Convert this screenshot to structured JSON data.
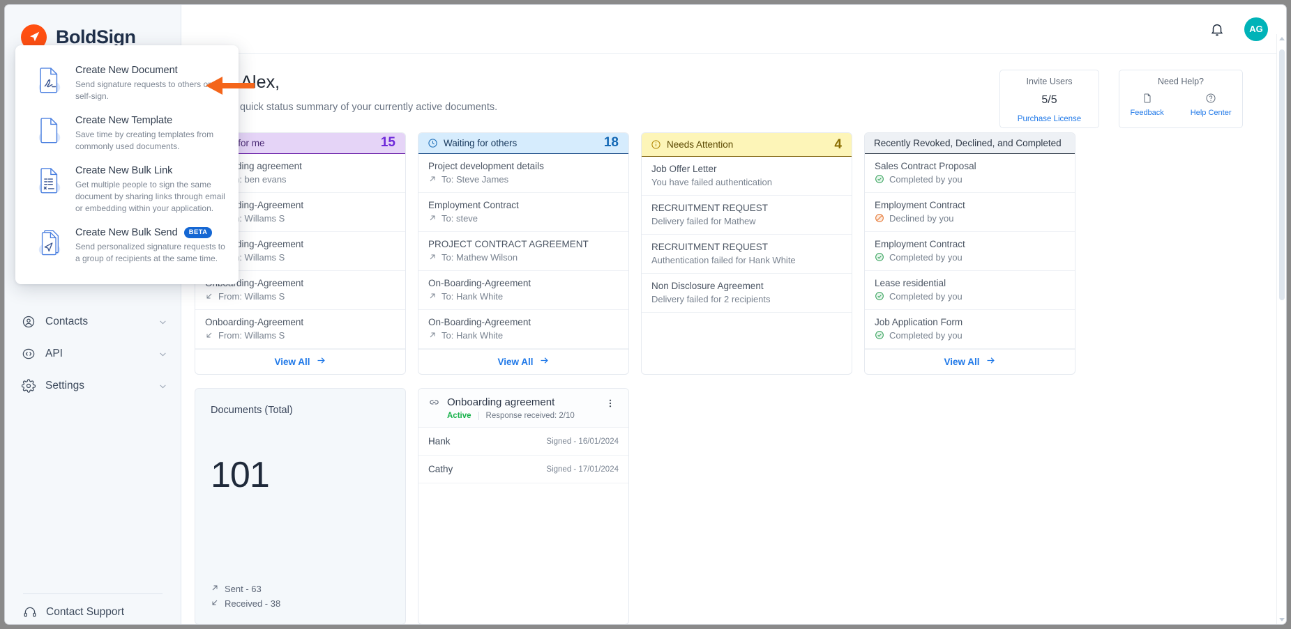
{
  "brand": {
    "name": "BoldSign"
  },
  "topbar": {
    "notification_icon": "bell-icon",
    "avatar_initials": "AG"
  },
  "sidebar": {
    "items": [
      {
        "label": "Contacts",
        "icon": "user-circle-icon"
      },
      {
        "label": "API",
        "icon": "code-circle-icon"
      },
      {
        "label": "Settings",
        "icon": "gear-icon"
      }
    ],
    "support": {
      "label": "Contact Support",
      "icon": "headset-icon"
    }
  },
  "dropdown": {
    "items": [
      {
        "title": "Create New Document",
        "desc": "Send signature requests to others or self-sign.",
        "icon": "document-sign-icon",
        "badge": ""
      },
      {
        "title": "Create New Template",
        "desc": "Save time by creating templates from commonly used documents.",
        "icon": "document-blank-icon",
        "badge": ""
      },
      {
        "title": "Create New Bulk Link",
        "desc": "Get multiple people to sign the same document by sharing links through email or embedding within your application.",
        "icon": "document-list-icon",
        "badge": ""
      },
      {
        "title": "Create New Bulk Send",
        "desc": "Send personalized signature requests to a group of recipients at the same time.",
        "icon": "document-send-icon",
        "badge": "BETA"
      }
    ]
  },
  "greeting": {
    "title": "Hello Alex,",
    "subtitle": "Here is a quick status summary of your currently active documents."
  },
  "header_cards": {
    "invite": {
      "title": "Invite Users",
      "value": "5/5",
      "link": "Purchase License"
    },
    "help": {
      "title": "Need Help?",
      "actions": [
        {
          "label": "Feedback",
          "icon": "document-icon"
        },
        {
          "label": "Help Center",
          "icon": "question-circle-icon"
        }
      ]
    }
  },
  "status_cards": [
    {
      "title": "Waiting for me",
      "count": "15",
      "icon": "",
      "theme": "purple",
      "items": [
        {
          "title": "Onboarding agreement",
          "sub": "From: ben evans",
          "dir": "in"
        },
        {
          "title": "Onboarding-Agreement",
          "sub": "From: Willams S",
          "dir": "in"
        },
        {
          "title": "Onboarding-Agreement",
          "sub": "From: Willams S",
          "dir": "in"
        },
        {
          "title": "Onboarding-Agreement",
          "sub": "From: Willams S",
          "dir": "in"
        },
        {
          "title": "Onboarding-Agreement",
          "sub": "From: Willams S",
          "dir": "in"
        }
      ],
      "footer": "View All"
    },
    {
      "title": "Waiting for others",
      "count": "18",
      "icon": "clock-icon",
      "theme": "blue",
      "items": [
        {
          "title": "Project development details",
          "sub": "To: Steve James",
          "dir": "out"
        },
        {
          "title": "Employment Contract",
          "sub": "To: steve",
          "dir": "out"
        },
        {
          "title": "PROJECT CONTRACT AGREEMENT",
          "sub": "To: Mathew Wilson",
          "dir": "out"
        },
        {
          "title": "On-Boarding-Agreement",
          "sub": "To: Hank White",
          "dir": "out"
        },
        {
          "title": "On-Boarding-Agreement",
          "sub": "To: Hank White",
          "dir": "out"
        }
      ],
      "footer": "View All"
    },
    {
      "title": "Needs Attention",
      "count": "4",
      "icon": "info-circle-icon",
      "theme": "yellow",
      "items": [
        {
          "title": "Job Offer Letter",
          "sub": "You have failed authentication",
          "dir": "none"
        },
        {
          "title": "RECRUITMENT REQUEST",
          "sub": "Delivery failed for Mathew",
          "dir": "none"
        },
        {
          "title": "RECRUITMENT REQUEST",
          "sub": "Authentication failed for Hank White",
          "dir": "none"
        },
        {
          "title": "Non Disclosure Agreement",
          "sub": "Delivery failed for 2 recipients",
          "dir": "none"
        }
      ],
      "footer": ""
    },
    {
      "title": "Recently Revoked, Declined, and Completed",
      "count": "",
      "icon": "",
      "theme": "gray",
      "items": [
        {
          "title": "Sales Contract Proposal",
          "sub": "Completed by you",
          "dir": "check"
        },
        {
          "title": "Employment Contract",
          "sub": "Declined by you",
          "dir": "declined"
        },
        {
          "title": "Employment Contract",
          "sub": "Completed by you",
          "dir": "check"
        },
        {
          "title": "Lease residential",
          "sub": "Completed by you",
          "dir": "check"
        },
        {
          "title": "Job Application Form",
          "sub": "Completed by you",
          "dir": "check"
        }
      ],
      "footer": "View All"
    }
  ],
  "documents_total": {
    "title": "Documents (Total)",
    "value": "101",
    "sent_label": "Sent - 63",
    "received_label": "Received - 38"
  },
  "bulk_card": {
    "title": "Onboarding agreement",
    "status": "Active",
    "response": "Response received: 2/10",
    "rows": [
      {
        "name": "Hank",
        "date": "Signed - 16/01/2024"
      },
      {
        "name": "Cathy",
        "date": "Signed - 17/01/2024"
      }
    ]
  },
  "colors": {
    "brand_orange": "#ff4f11",
    "brand_navy": "#20304a",
    "accent_blue": "#1f78e8",
    "avatar_teal": "#00b3b8",
    "purple_head": "#e5d4f7",
    "blue_head": "#d6ecfd",
    "yellow_head": "#fdf5b8",
    "gray_head": "#eef1f5",
    "arrow_orange": "#f4651a",
    "status_green": "#18b24b"
  }
}
